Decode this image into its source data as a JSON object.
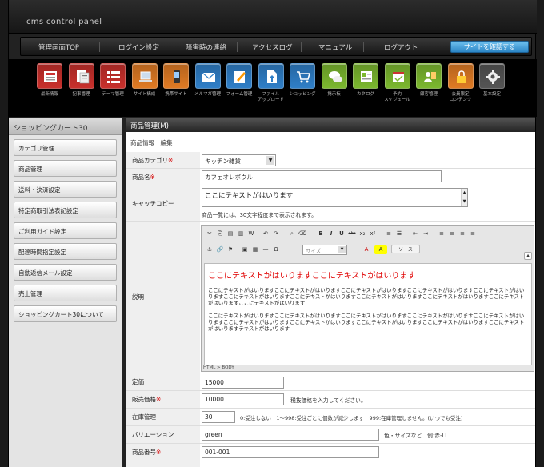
{
  "app": {
    "title": "cms control panel"
  },
  "nav": {
    "items": [
      {
        "label": "管理画面TOP"
      },
      {
        "label": "ログイン設定"
      },
      {
        "label": "障害時の連絡"
      },
      {
        "label": "アクセスログ"
      },
      {
        "label": "マニュアル"
      },
      {
        "label": "ログアウト"
      }
    ],
    "site_button": "サイトを確認する"
  },
  "icons": [
    {
      "label": "最新情報",
      "icon": "news-icon",
      "color": "#c9302c"
    },
    {
      "label": "記事管理",
      "icon": "article-icon",
      "color": "#c9302c"
    },
    {
      "label": "テーマ管理",
      "icon": "theme-list-icon",
      "color": "#c9302c"
    },
    {
      "label": "サイト構成",
      "icon": "laptop-icon",
      "color": "#e07b24"
    },
    {
      "label": "携帯サイト",
      "icon": "mobile-icon",
      "color": "#e07b24"
    },
    {
      "label": "メルマガ管理",
      "icon": "mail-icon",
      "color": "#2f7fc8"
    },
    {
      "label": "フォーム管理",
      "icon": "form-icon",
      "color": "#2f7fc8"
    },
    {
      "label": "ファイル\nアップロード",
      "icon": "file-upload-icon",
      "color": "#2f7fc8"
    },
    {
      "label": "ショッピング",
      "icon": "cart-icon",
      "color": "#2f7fc8"
    },
    {
      "label": "掲示板",
      "icon": "bbs-icon",
      "color": "#7cb82f"
    },
    {
      "label": "カタログ",
      "icon": "catalog-icon",
      "color": "#7cb82f"
    },
    {
      "label": "予約\nスケジュール",
      "icon": "schedule-icon",
      "color": "#7cb82f"
    },
    {
      "label": "顧客管理",
      "icon": "customer-icon",
      "color": "#7cb82f"
    },
    {
      "label": "会員限定\nコンテンツ",
      "icon": "lock-icon",
      "color": "#e07b24"
    },
    {
      "label": "基本設定",
      "icon": "gear-icon",
      "color": "#555555"
    }
  ],
  "sidebar": {
    "title": "ショッピングカート30",
    "items": [
      {
        "label": "カテゴリ管理"
      },
      {
        "label": "商品管理"
      },
      {
        "label": "送料・決済設定"
      },
      {
        "label": "特定商取引法表記設定"
      },
      {
        "label": "ご利用ガイド設定"
      },
      {
        "label": "配達時間指定設定"
      },
      {
        "label": "自動返信メール設定"
      },
      {
        "label": "売上管理"
      },
      {
        "label": "ショッピングカート30について"
      }
    ]
  },
  "main": {
    "title": "商品管理(M)",
    "subheading": "商品情報　編集",
    "fields": {
      "category": {
        "label": "商品カテゴリ",
        "req": "※",
        "value": "キッチン雑貨"
      },
      "name": {
        "label": "商品名",
        "req": "※",
        "value": "カフェオレボウル"
      },
      "catch": {
        "label": "キャッチコピー",
        "value": "ここにテキストがはいります",
        "note": "商品一覧には、30文字程度まで表示されます。"
      },
      "desc": {
        "label": "説明"
      },
      "list_price": {
        "label": "定価",
        "value": "15000"
      },
      "sale_price": {
        "label": "販売価格",
        "req": "※",
        "value": "10000",
        "note": "税抜価格を入力してください。"
      },
      "stock": {
        "label": "在庫管理",
        "value": "30",
        "note": "0:受注しない　1〜998:受注ごとに個数が減少します　999:在庫管理しません。(いつでも受注)"
      },
      "variation": {
        "label": "バリエーション",
        "value": "green",
        "note": "色・サイズなど　例:赤-LL"
      },
      "code": {
        "label": "商品番号",
        "req": "※",
        "value": "001-001"
      }
    },
    "editor": {
      "source_label": "ソース",
      "size_placeholder": "サイズ",
      "heading": "ここにテキストがはいりますここにテキストがはいります",
      "para1": "ここにテキストがはいりますここにテキストがはいりますここにテキストがはいりますここにテキストがはいりますここにテキストがはいりますここにテキストがはいりますここにテキストがはいりますここにテキストがはいりますここにテキストがはいりますここにテキストがはいりますここにテキストがはいります",
      "para2": "ここにテキストがはいりますここにテキストがはいりますここにテキストがはいりますここにテキストがはいりますここにテキストがはいりますここにテキストがはいりますここにテキストがはいりますここにテキストがはいりますここにテキストがはいりますここにテキストがはいりますテキストがはいります",
      "footer": "HTML > BODY"
    }
  }
}
